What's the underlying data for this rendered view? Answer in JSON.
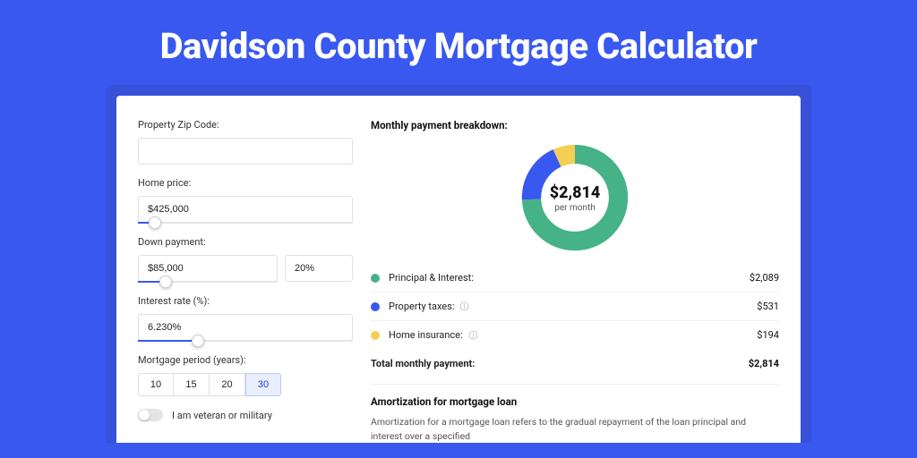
{
  "header": {
    "title": "Davidson County Mortgage Calculator"
  },
  "form": {
    "zip": {
      "label": "Property Zip Code:",
      "value": ""
    },
    "price": {
      "label": "Home price:",
      "value": "$425,000",
      "slider_pct": 8
    },
    "down": {
      "label": "Down payment:",
      "amount": "$85,000",
      "pct": "20%",
      "slider_pct": 20
    },
    "rate": {
      "label": "Interest rate (%):",
      "value": "6.230%",
      "slider_pct": 28
    },
    "period": {
      "label": "Mortgage period (years):",
      "options": [
        "10",
        "15",
        "20",
        "30"
      ],
      "active_index": 3
    },
    "veteran": {
      "label": "I am veteran or military",
      "on": false
    }
  },
  "breakdown": {
    "title": "Monthly payment breakdown:",
    "center_amount": "$2,814",
    "center_sub": "per month",
    "items": [
      {
        "label": "Principal & Interest:",
        "value": "$2,089",
        "color": "green",
        "info": false
      },
      {
        "label": "Property taxes:",
        "value": "$531",
        "color": "blue",
        "info": true
      },
      {
        "label": "Home insurance:",
        "value": "$194",
        "color": "yellow",
        "info": true
      }
    ],
    "total_label": "Total monthly payment:",
    "total_value": "$2,814"
  },
  "amort": {
    "title": "Amortization for mortgage loan",
    "text": "Amortization for a mortgage loan refers to the gradual repayment of the loan principal and interest over a specified"
  },
  "chart_data": {
    "type": "pie",
    "title": "Monthly payment breakdown",
    "series": [
      {
        "name": "Principal & Interest",
        "value": 2089,
        "color": "#46b288"
      },
      {
        "name": "Property taxes",
        "value": 531,
        "color": "#3858f0"
      },
      {
        "name": "Home insurance",
        "value": 194,
        "color": "#f3cf55"
      }
    ],
    "total": 2814,
    "unit": "$ per month"
  }
}
